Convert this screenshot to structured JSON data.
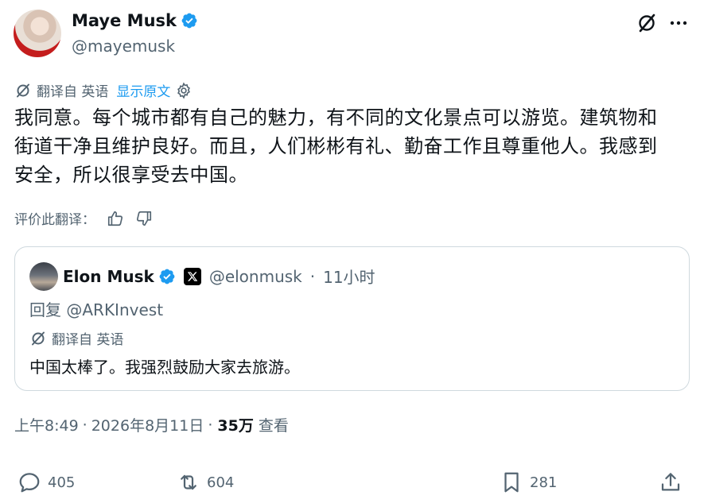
{
  "author": {
    "name": "Maye Musk",
    "handle": "@mayemusk"
  },
  "translation": {
    "label": "翻译自 英语",
    "show_original": "显示原文"
  },
  "body_lines": [
    "我同意。每个城市都有自己的魅力，有不同的文化景点可以游览。建筑物和",
    "街道干净且维护良好。而且，人们彬彬有礼、勤奋工作且尊重他人。我感到",
    "安全，所以很享受去中国。"
  ],
  "rate": {
    "label": "评价此翻译："
  },
  "quote": {
    "name": "Elon Musk",
    "handle": "@elonmusk",
    "separator": "·",
    "time": "11小时",
    "reply_prefix": "回复",
    "reply_to": "@ARKInvest",
    "translated_label": "翻译自 英语",
    "text": "中国太棒了。我强烈鼓励大家去旅游。"
  },
  "meta": {
    "time": "上午8:49",
    "sep1": "·",
    "date": "2026年8月11日",
    "sep2": "·",
    "views_count": "35万",
    "views_label": "查看"
  },
  "actions": {
    "replies": "405",
    "reposts": "604",
    "bookmarks": "281"
  },
  "colors": {
    "accent": "#1d9bf0",
    "muted": "#536471",
    "border": "#cfd9de"
  },
  "icons": [
    "grok-icon",
    "more-icon",
    "translate-icon",
    "settings-icon",
    "thumbs-up-icon",
    "thumbs-down-icon",
    "verified-icon",
    "x-logo-icon",
    "reply-icon",
    "repost-icon",
    "bookmark-icon",
    "share-icon"
  ]
}
